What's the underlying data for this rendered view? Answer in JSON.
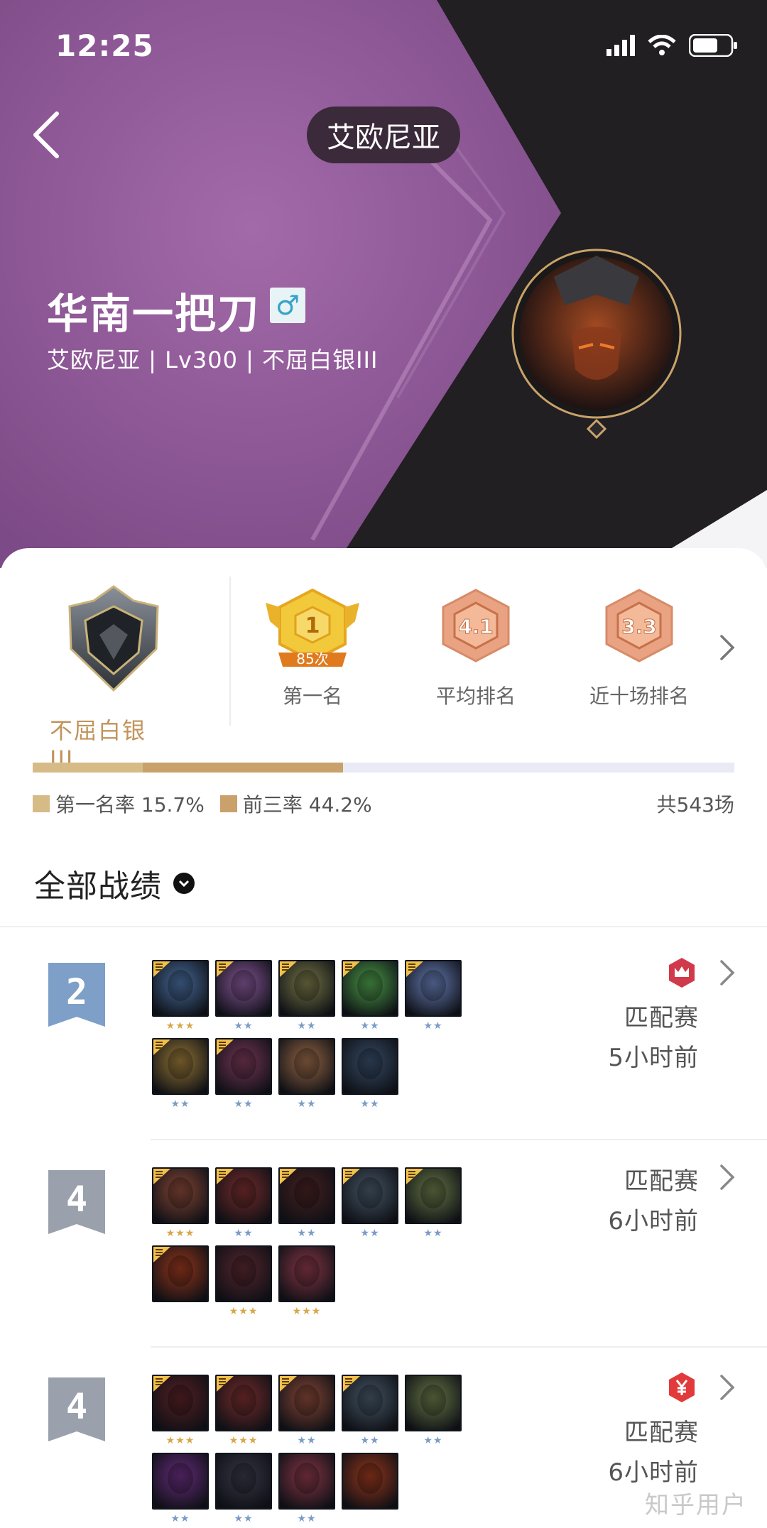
{
  "status_bar": {
    "time": "12:25"
  },
  "header": {
    "region_pill": "艾欧尼亚",
    "player_name": "华南一把刀",
    "gender_symbol": "♂",
    "subtitle": "艾欧尼亚 | Lv300 | 不屈白银III"
  },
  "rank": {
    "name": "不屈白银 III"
  },
  "stats": [
    {
      "label": "第一名",
      "badge_value": "1",
      "badge_sub": "85次"
    },
    {
      "label": "平均排名",
      "badge_value": "4.1"
    },
    {
      "label": "近十场排名",
      "badge_value": "3.3"
    }
  ],
  "summary": {
    "first_rate_label": "第一名率 15.7%",
    "top3_rate_label": "前三率 44.2%",
    "first_rate": 0.157,
    "top3_rate": 0.442,
    "total_label": "共543场",
    "colors": {
      "first": "#d7bb86",
      "top3": "#caa16a",
      "track": "#e8eaf5"
    }
  },
  "section": {
    "title": "全部战绩"
  },
  "matches": [
    {
      "placement": "2",
      "placement_color": "#7d9fc8",
      "mode": "匹配赛",
      "time": "5小时前",
      "mode_icon": "crown-hexagon-icon",
      "units": [
        {
          "stars": 3,
          "color": "#3b5f8e",
          "tag": true
        },
        {
          "stars": 2,
          "color": "#7a4a8c",
          "tag": true
        },
        {
          "stars": 2,
          "color": "#6b6a3a",
          "tag": true
        },
        {
          "stars": 2,
          "color": "#3f8f3c",
          "tag": true
        },
        {
          "stars": 2,
          "color": "#5a6fa8",
          "tag": true
        },
        {
          "stars": 2,
          "color": "#8a6a2a",
          "tag": true
        },
        {
          "stars": 2,
          "color": "#6a2a4a",
          "tag": true
        },
        {
          "stars": 2,
          "color": "#8a5a3a",
          "tag": false
        },
        {
          "stars": 2,
          "color": "#2a3f5a",
          "tag": false
        }
      ]
    },
    {
      "placement": "4",
      "placement_color": "#9aa1ad",
      "mode": "匹配赛",
      "time": "6小时前",
      "mode_icon": "",
      "units": [
        {
          "stars": 3,
          "color": "#7a3a2a",
          "tag": true
        },
        {
          "stars": 2,
          "color": "#6a2020",
          "tag": true
        },
        {
          "stars": 2,
          "color": "#3a1414",
          "tag": true
        },
        {
          "stars": 2,
          "color": "#3a4a5a",
          "tag": true
        },
        {
          "stars": 2,
          "color": "#5a6a3a",
          "tag": true
        },
        {
          "stars": 0,
          "color": "#8a2a10",
          "tag": true
        },
        {
          "stars": 3,
          "color": "#4a1a22",
          "tag": false
        },
        {
          "stars": 3,
          "color": "#7a2a3a",
          "tag": false
        }
      ]
    },
    {
      "placement": "4",
      "placement_color": "#9aa1ad",
      "mode": "匹配赛",
      "time": "6小时前",
      "mode_icon": "currency-hexagon-icon",
      "units": [
        {
          "stars": 3,
          "color": "#4a1418",
          "tag": true
        },
        {
          "stars": 3,
          "color": "#6a2020",
          "tag": true
        },
        {
          "stars": 2,
          "color": "#7a3a2a",
          "tag": true
        },
        {
          "stars": 2,
          "color": "#3a4a5a",
          "tag": true
        },
        {
          "stars": 2,
          "color": "#5a6a3a",
          "tag": false
        },
        {
          "stars": 2,
          "color": "#5a2070",
          "tag": false
        },
        {
          "stars": 2,
          "color": "#2a2a3a",
          "tag": false
        },
        {
          "stars": 2,
          "color": "#7a2a3a",
          "tag": false
        },
        {
          "stars": 0,
          "color": "#8a2a10",
          "tag": false
        }
      ]
    }
  ],
  "watermark": "知乎用户"
}
